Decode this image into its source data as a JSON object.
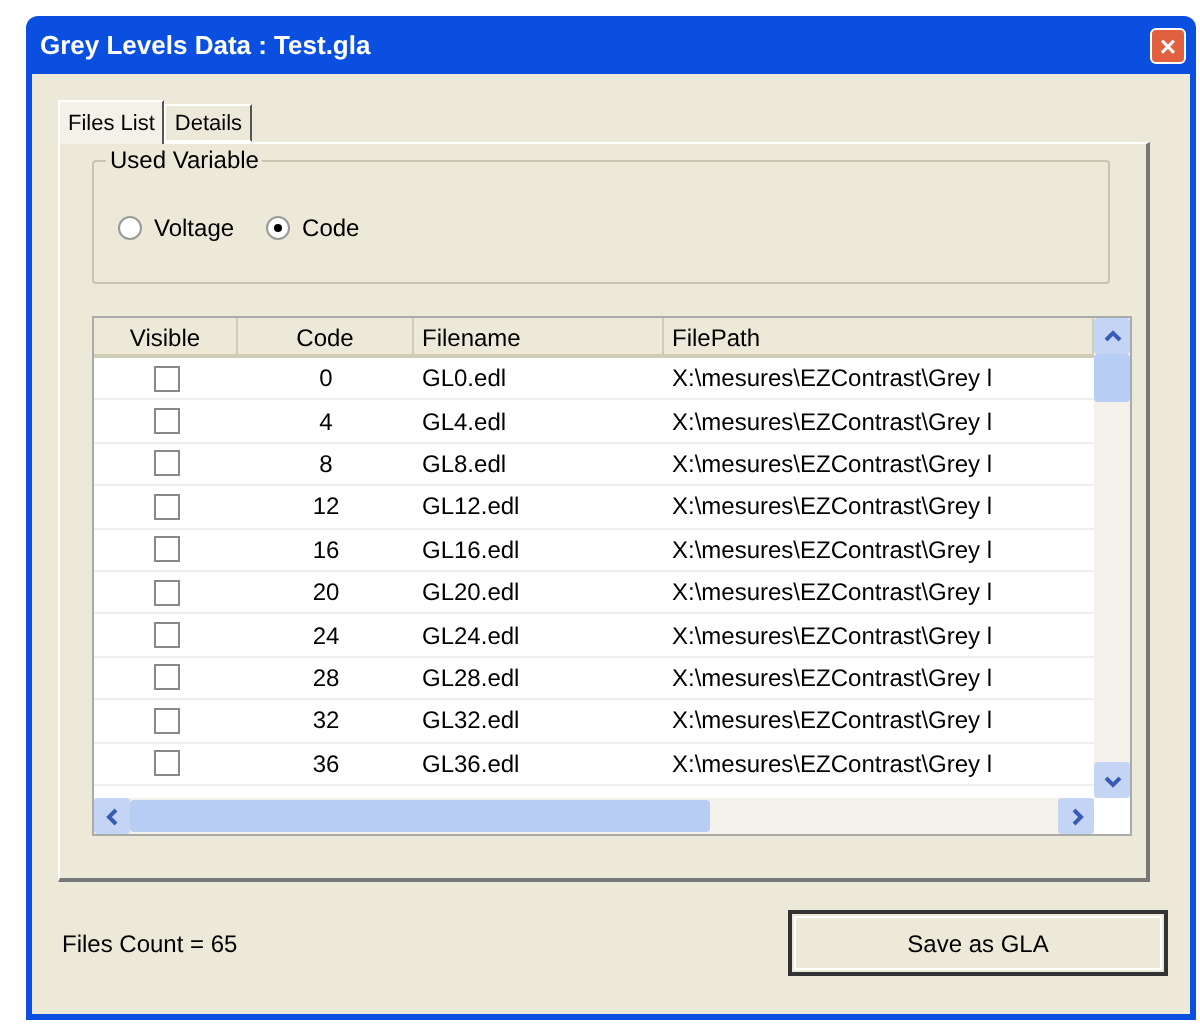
{
  "window": {
    "title": "Grey Levels Data : Test.gla",
    "close": "×"
  },
  "tabs": [
    {
      "label": "Files List",
      "selected": true
    },
    {
      "label": "Details",
      "selected": false
    }
  ],
  "used_variable": {
    "title": "Used Variable",
    "options": [
      {
        "label": "Voltage",
        "selected": false
      },
      {
        "label": "Code",
        "selected": true
      }
    ]
  },
  "table": {
    "columns": [
      "Visible",
      "Code",
      "Filename",
      "FilePath"
    ],
    "rows": [
      {
        "visible": false,
        "code": "0",
        "filename": "GL0.edl",
        "filepath": "X:\\mesures\\EZContrast\\Grey l"
      },
      {
        "visible": false,
        "code": "4",
        "filename": "GL4.edl",
        "filepath": "X:\\mesures\\EZContrast\\Grey l"
      },
      {
        "visible": false,
        "code": "8",
        "filename": "GL8.edl",
        "filepath": "X:\\mesures\\EZContrast\\Grey l"
      },
      {
        "visible": false,
        "code": "12",
        "filename": "GL12.edl",
        "filepath": "X:\\mesures\\EZContrast\\Grey l"
      },
      {
        "visible": false,
        "code": "16",
        "filename": "GL16.edl",
        "filepath": "X:\\mesures\\EZContrast\\Grey l"
      },
      {
        "visible": false,
        "code": "20",
        "filename": "GL20.edl",
        "filepath": "X:\\mesures\\EZContrast\\Grey l"
      },
      {
        "visible": false,
        "code": "24",
        "filename": "GL24.edl",
        "filepath": "X:\\mesures\\EZContrast\\Grey l"
      },
      {
        "visible": false,
        "code": "28",
        "filename": "GL28.edl",
        "filepath": "X:\\mesures\\EZContrast\\Grey l"
      },
      {
        "visible": false,
        "code": "32",
        "filename": "GL32.edl",
        "filepath": "X:\\mesures\\EZContrast\\Grey l"
      },
      {
        "visible": false,
        "code": "36",
        "filename": "GL36.edl",
        "filepath": "X:\\mesures\\EZContrast\\Grey l"
      }
    ]
  },
  "files_count": "Files Count = 65",
  "save_button": "Save as GLA"
}
